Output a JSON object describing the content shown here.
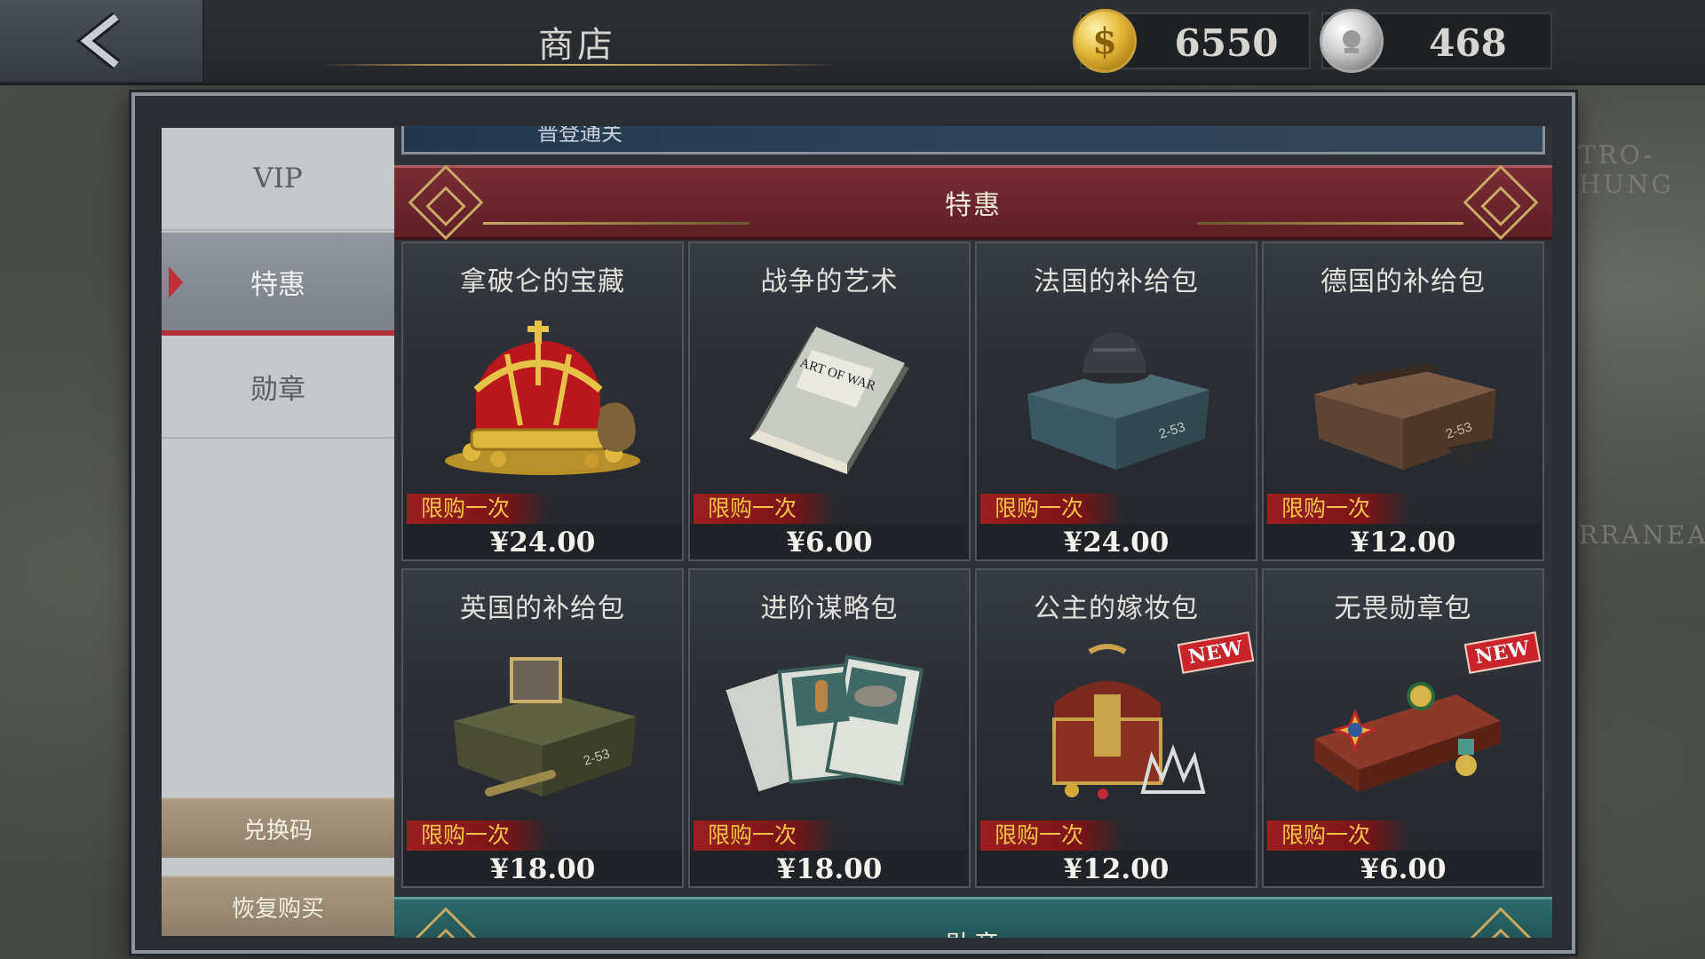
{
  "header": {
    "title": "商店",
    "gold_amount": "6550",
    "silver_amount": "468"
  },
  "map": {
    "label_1": "TRO-HUNG",
    "label_2": "RRANEAN"
  },
  "sidebar": {
    "items": [
      {
        "label": "VIP"
      },
      {
        "label": "特惠"
      },
      {
        "label": "勋章"
      }
    ],
    "redeem_label": "兑换码",
    "restore_label": "恢复购买"
  },
  "content": {
    "prev_banner_label": "晋登通关",
    "section_title": "特惠",
    "next_section_title": "勋章",
    "cards": [
      {
        "name": "拿破仑的宝藏",
        "limit": "限购一次",
        "price": "¥24.00",
        "icon": "crown-treasure-icon",
        "new": ""
      },
      {
        "name": "战争的艺术",
        "limit": "限购一次",
        "price": "¥6.00",
        "icon": "art-of-war-book-icon",
        "new": ""
      },
      {
        "name": "法国的补给包",
        "limit": "限购一次",
        "price": "¥24.00",
        "icon": "french-supply-crate-icon",
        "new": ""
      },
      {
        "name": "德国的补给包",
        "limit": "限购一次",
        "price": "¥12.00",
        "icon": "german-supply-crate-icon",
        "new": ""
      },
      {
        "name": "英国的补给包",
        "limit": "限购一次",
        "price": "¥18.00",
        "icon": "british-supply-crate-icon",
        "new": ""
      },
      {
        "name": "进阶谋略包",
        "limit": "限购一次",
        "price": "¥18.00",
        "icon": "strategy-cards-icon",
        "new": ""
      },
      {
        "name": "公主的嫁妆包",
        "limit": "限购一次",
        "price": "¥12.00",
        "icon": "dowry-chest-icon",
        "new": "NEW"
      },
      {
        "name": "无畏勋章包",
        "limit": "限购一次",
        "price": "¥6.00",
        "icon": "medal-box-icon",
        "new": "NEW"
      }
    ],
    "book_title": "ART OF WAR",
    "crate_code": "2-53"
  },
  "colors": {
    "accent_red": "#7a2c34",
    "limit_text": "#f6c34a",
    "teal_header": "#2e6b6a"
  }
}
